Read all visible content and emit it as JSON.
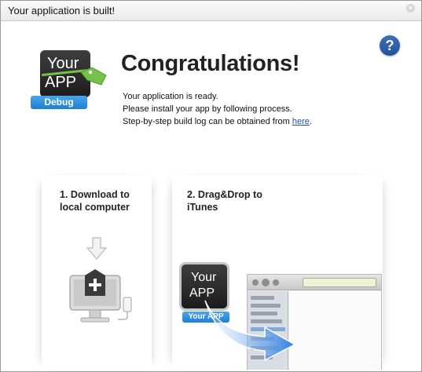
{
  "window": {
    "title": "Your application is built!",
    "close_symbol": "×"
  },
  "help": {
    "symbol": "?"
  },
  "app_icon": {
    "line1": "Your",
    "line2": "APP",
    "badge": "Debug"
  },
  "main": {
    "headline": "Congratulations!",
    "message_line1": "Your application is ready.",
    "message_line2": "Please install your app by following process.",
    "message_line3_prefix": "Step-by-step build log can be obtained from ",
    "message_link": "here",
    "message_line3_suffix": "."
  },
  "steps": [
    {
      "title_line1": "1. Download to",
      "title_line2": "local computer"
    },
    {
      "title_line1": "2. Drag&Drop to",
      "title_line2": "iTunes"
    }
  ],
  "step2_app": {
    "line1": "Your",
    "line2": "APP",
    "badge": "Your APP"
  },
  "colors": {
    "badge_blue": "#2a88d8",
    "link_blue": "#1f4fb0",
    "help_blue": "#2f5fa8",
    "tag_green": "#77c14a",
    "arrow_blue": "#2f7fe0"
  },
  "icons": [
    "close-icon",
    "help-icon",
    "price-tag-icon",
    "down-arrow-icon",
    "monitor-download-icon",
    "phone-icon",
    "drag-arrow-icon"
  ]
}
